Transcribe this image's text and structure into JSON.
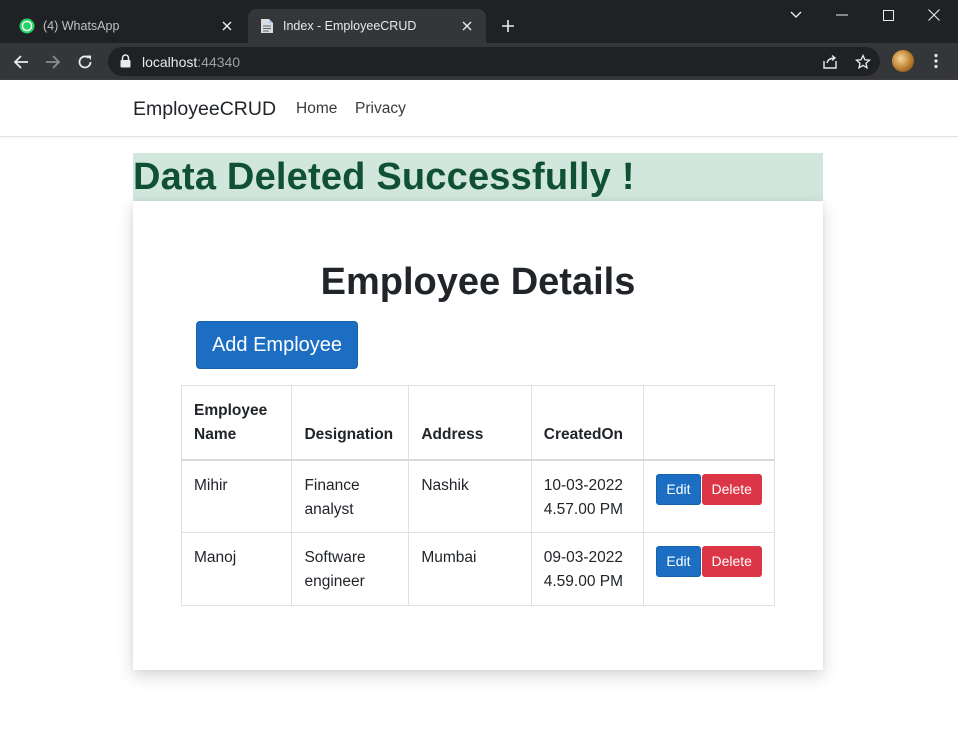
{
  "browser": {
    "tabs": [
      {
        "title": "(4) WhatsApp",
        "icon": "whatsapp-icon",
        "active": false
      },
      {
        "title": "Index - EmployeeCRUD",
        "icon": "page-icon",
        "active": true
      }
    ],
    "url_host": "localhost",
    "url_port": ":44340"
  },
  "navbar": {
    "brand": "EmployeeCRUD",
    "links": [
      "Home",
      "Privacy"
    ]
  },
  "alert": {
    "message": "Data Deleted Successfully !",
    "bg_color": "#d1e7dd",
    "text_color": "#0f5132"
  },
  "main": {
    "heading": "Employee Details",
    "add_button": "Add Employee",
    "table": {
      "headers": [
        "Employee Name",
        "Designation",
        "Address",
        "CreatedOn",
        ""
      ],
      "rows": [
        {
          "name": "Mihir",
          "designation": "Finance analyst",
          "address": "Nashik",
          "created_on": "10-03-2022 4.57.00 PM",
          "edit": "Edit",
          "delete": "Delete"
        },
        {
          "name": "Manoj",
          "designation": "Software engineer",
          "address": "Mumbai",
          "created_on": "09-03-2022 4.59.00 PM",
          "edit": "Edit",
          "delete": "Delete"
        }
      ]
    }
  },
  "colors": {
    "primary": "#1b6ec2",
    "danger": "#dc3545"
  }
}
